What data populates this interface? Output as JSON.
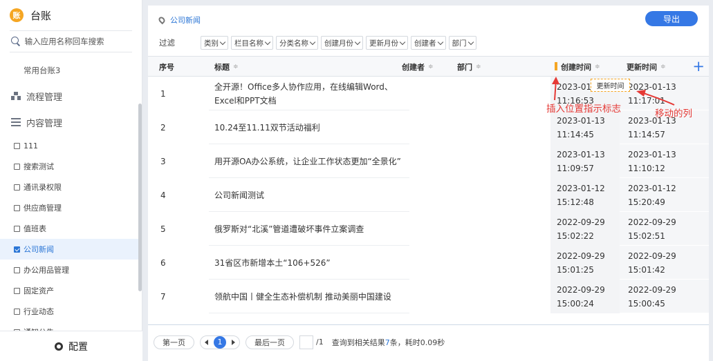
{
  "app": {
    "logo": "账",
    "title": "台账"
  },
  "search": {
    "placeholder": "输入应用名称回车搜索"
  },
  "nav": {
    "top_item": "常用台账3",
    "group_flow": "流程管理",
    "group_content": "内容管理",
    "items": [
      {
        "label": "111",
        "checked": false
      },
      {
        "label": "搜索测试",
        "checked": false
      },
      {
        "label": "通讯录权限",
        "checked": false
      },
      {
        "label": "供应商管理",
        "checked": false
      },
      {
        "label": "值班表",
        "checked": false
      },
      {
        "label": "公司新闻",
        "checked": true
      },
      {
        "label": "办公用品管理",
        "checked": false
      },
      {
        "label": "固定资产",
        "checked": false
      },
      {
        "label": "行业动态",
        "checked": false
      },
      {
        "label": "通知公告",
        "checked": false
      }
    ],
    "footer": "配置"
  },
  "breadcrumb": "公司新闻",
  "export_label": "导出",
  "filter": {
    "label": "过滤",
    "buttons": [
      "类别",
      "栏目名称",
      "分类名称",
      "创建月份",
      "更新月份",
      "创建者",
      "部门"
    ]
  },
  "table": {
    "headers": {
      "index": "序号",
      "title": "标题",
      "creator": "创建者",
      "dept": "部门",
      "created": "创建时间",
      "updated": "更新时间"
    },
    "sort_glyph": "≑",
    "add_glyph": "+",
    "rows": [
      {
        "index": "1",
        "title_l1": "全开源！Office多人协作应用，在线编辑Word、",
        "title_l2": "Excel和PPT文档",
        "created_date": "2023-01-13",
        "created_time": "11:16:53",
        "updated_date": "2023-01-13",
        "updated_time": "11:17:01"
      },
      {
        "index": "2",
        "title_l1": "10.24至11.11双节活动福利",
        "title_l2": "",
        "created_date": "2023-01-13",
        "created_time": "11:14:45",
        "updated_date": "2023-01-13",
        "updated_time": "11:14:57"
      },
      {
        "index": "3",
        "title_l1": "用开源OA办公系统，让企业工作状态更加“全景化”",
        "title_l2": "",
        "created_date": "2023-01-13",
        "created_time": "11:09:57",
        "updated_date": "2023-01-13",
        "updated_time": "11:10:12"
      },
      {
        "index": "4",
        "title_l1": "公司新闻测试",
        "title_l2": "",
        "created_date": "2023-01-12",
        "created_time": "15:12:48",
        "updated_date": "2023-01-12",
        "updated_time": "15:20:49"
      },
      {
        "index": "5",
        "title_l1": "俄罗斯对“北溪”管道遭破坏事件立案调查",
        "title_l2": "",
        "created_date": "2022-09-29",
        "created_time": "15:02:22",
        "updated_date": "2022-09-29",
        "updated_time": "15:02:51"
      },
      {
        "index": "6",
        "title_l1": "31省区市新增本土“106+526”",
        "title_l2": "",
        "created_date": "2022-09-29",
        "created_time": "15:01:25",
        "updated_date": "2022-09-29",
        "updated_time": "15:01:42"
      },
      {
        "index": "7",
        "title_l1": "领航中国丨健全生态补偿机制 推动美丽中国建设",
        "title_l2": "",
        "created_date": "2022-09-29",
        "created_time": "15:00:24",
        "updated_date": "2022-09-29",
        "updated_time": "15:00:45"
      }
    ]
  },
  "drag_ghost": "更新时间",
  "annotations": {
    "insert": "插入位置指示标志",
    "moving": "移动的列"
  },
  "pager": {
    "first": "第一页",
    "current": "1",
    "last": "最后一页",
    "total_pages": "/1",
    "info_prefix": "查询到相关结果",
    "count": "7",
    "info_suffix": "条，耗时0.09秒"
  },
  "colors": {
    "accent": "#3578e5",
    "annotation": "#e53935",
    "insert_marker": "#f5a623"
  }
}
